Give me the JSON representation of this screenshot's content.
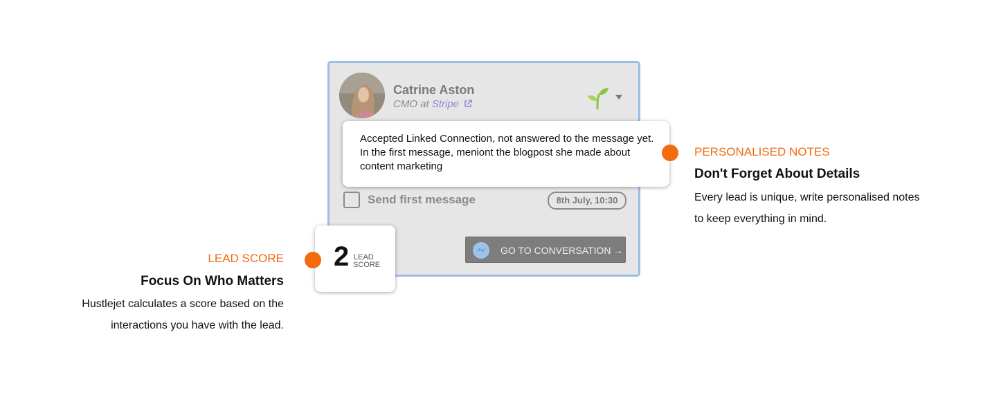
{
  "lead_card": {
    "name": "Catrine Aston",
    "role_prefix": "CMO at ",
    "company": "Stripe",
    "stage_icon": "sprout-icon",
    "note": "Accepted Linked Connection, not answered to the message yet. In the first message, meniont the blogpost she made about content marketing",
    "task_label": "Send first message",
    "task_done": false,
    "task_date": "8th July, 10:30",
    "conversation_button": "GO TO CONVERSATION →",
    "conversation_icon": "messenger-icon"
  },
  "lead_score": {
    "value": "2",
    "label_line1": "LEAD",
    "label_line2": "SCORE"
  },
  "callouts": {
    "notes": {
      "tag": "PERSONALISED NOTES",
      "title": "Don't Forget About Details",
      "desc": "Every lead is unique, write personalised notes to keep everything in mind."
    },
    "score": {
      "tag": "LEAD SCORE",
      "title": "Focus On Who Matters",
      "desc": "Hustlejet calculates a score based on the interactions you have with the lead."
    }
  },
  "colors": {
    "accent": "#f26b0f",
    "card_border": "#9bbde6",
    "company_link": "#8f84d9",
    "card_bg": "#e6e6e6"
  }
}
